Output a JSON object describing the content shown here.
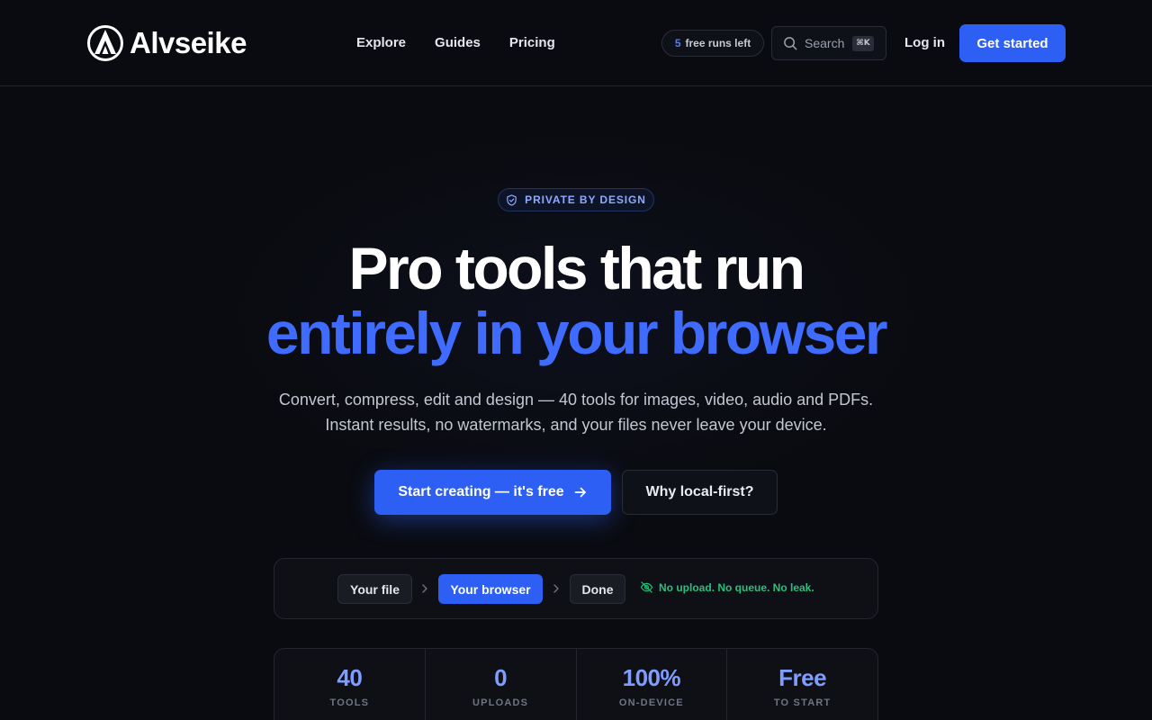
{
  "brand": {
    "name": "Alvseike"
  },
  "nav": {
    "items": [
      "Explore",
      "Guides",
      "Pricing"
    ]
  },
  "header": {
    "runs_count": "5",
    "runs_label": "free runs left",
    "search_label": "Search",
    "search_shortcut": "⌘K",
    "login_label": "Log in",
    "cta_label": "Get started"
  },
  "hero": {
    "pill": "PRIVATE BY DESIGN",
    "headline_line1": "Pro tools that run",
    "headline_line2": "entirely in your browser",
    "subcopy": "Convert, compress, edit and design — 40 tools for images, video, audio and PDFs. Instant results, no watermarks, and your files never leave your device.",
    "primary_cta": "Start creating — it's free",
    "secondary_cta": "Why local-first?"
  },
  "flow": {
    "steps": [
      "Your file",
      "Your browser",
      "Done"
    ],
    "note": "No upload. No queue. No leak."
  },
  "stats": [
    {
      "value": "40",
      "label": "TOOLS"
    },
    {
      "value": "0",
      "label": "UPLOADS"
    },
    {
      "value": "100%",
      "label": "ON-DEVICE"
    },
    {
      "value": "Free",
      "label": "TO START"
    }
  ],
  "colors": {
    "background": "#0a0b10",
    "accent": "#2d5ff5",
    "headline_accent": "#3f6cff",
    "success": "#2bbf7d"
  }
}
